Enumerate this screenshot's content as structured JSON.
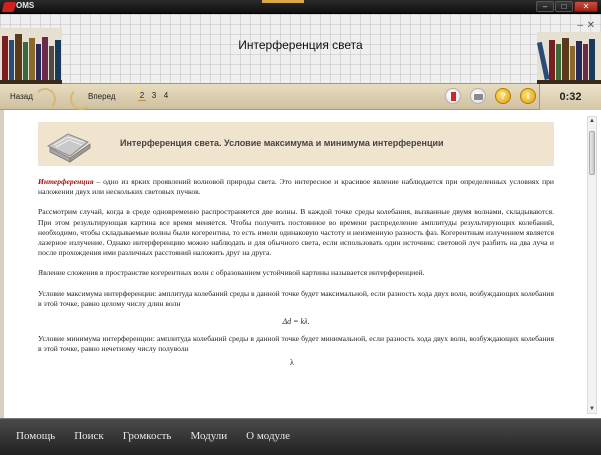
{
  "window": {
    "app_title": "OMS",
    "controls": {
      "minimize": "–",
      "maximize": "□",
      "close": "✕"
    }
  },
  "header": {
    "title": "Интерференция света",
    "shelf_controls": {
      "minimize": "–",
      "close": "✕"
    }
  },
  "navbar": {
    "back_label": "Назад",
    "forward_label": "Вперед",
    "pages": [
      "2",
      "3",
      "4"
    ],
    "tools": [
      "bookmark-icon",
      "print-icon",
      "help-icon",
      "info-icon"
    ],
    "help_glyph": "?",
    "info_glyph": "i",
    "timer": "0:32"
  },
  "content": {
    "topic_title": "Интерференция света. Условие максимума и минимума интерференции",
    "term": "Интерференция",
    "paragraph1_rest": " – одно из ярких проявлений волновой природы света. Это интересное и красивое явление наблюдается при определенных условиях при наложении двух или нескольких световых пучков.",
    "paragraph2": "Рассмотрим случай, когда в среде одновременно распространяется две волны. В каждой точке среды колебания, вызванные двумя волнами, складываются. При этом результирующая картина все время меняется. Чтобы получить постоянное во времени распределение амплитуды результирующих колебаний, необходимо, чтобы складываемые волны были когерентны, то есть имели одинаковую частоту и неизменную разность фаз. Когерентным излучением является лазерное излучение. Однако интерференцию можно наблюдать и для обычного света, если использовать один источник: световой луч разбить на два луча и после прохождения ими различных расстояний наложить друг на друга.",
    "paragraph3": "Явление сложения в пространстве когерентных волн с образованием устойчивой картины называется интерференцией.",
    "paragraph4": "Условие максимума интерференции: амплитуда колебаний среды в данной точке будет максимальной, если разность хода двух волн, возбуждающих колебания в этой точке, равно целому числу длин волн",
    "formula1": "Δd = kλ.",
    "paragraph5": "Условие минимума интерференции: амплитуда колебаний среды в данной точке будет минимальной, если разность хода двух волн, возбуждающих колебания в этой точке, равно нечетному числу полуволн",
    "formula2_cut": "λ"
  },
  "scrollbar": {
    "up": "▲",
    "down": "▼"
  },
  "bottom_menu": [
    "Помощь",
    "Поиск",
    "Громкость",
    "Модули",
    "О модуле"
  ],
  "colors": {
    "term_color": "#a01414",
    "banner_bg": "#f1e4cf",
    "navbar_bg": "#d9cbaa"
  }
}
